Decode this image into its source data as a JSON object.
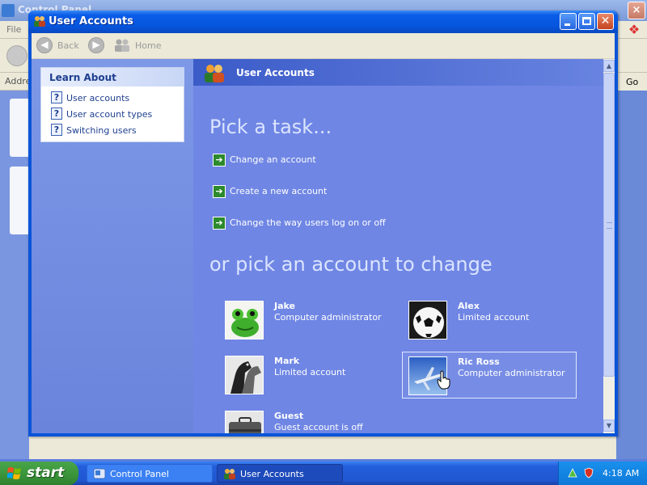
{
  "background_window": {
    "title": "Control Panel",
    "menu_first": "File",
    "address_label": "Address",
    "go_label": "Go"
  },
  "window": {
    "title": "User Accounts",
    "nav": {
      "back": "Back",
      "home": "Home"
    }
  },
  "learn_about": {
    "heading": "Learn About",
    "items": [
      {
        "label": "User accounts"
      },
      {
        "label": "User account types"
      },
      {
        "label": "Switching users"
      }
    ]
  },
  "main": {
    "header": "User Accounts",
    "pick_task": "Pick a task...",
    "tasks": [
      {
        "label": "Change an account"
      },
      {
        "label": "Create a new account"
      },
      {
        "label": "Change the way users log on or off"
      }
    ],
    "pick_account": "or pick an account to change",
    "accounts": [
      {
        "name": "Jake",
        "type": "Computer administrator",
        "picture": "frog"
      },
      {
        "name": "Alex",
        "type": "Limited account",
        "picture": "soccer-ball"
      },
      {
        "name": "Mark",
        "type": "Limited account",
        "picture": "horse"
      },
      {
        "name": "Ric Ross",
        "type": "Computer administrator",
        "picture": "airplane",
        "selected": true
      },
      {
        "name": "Guest",
        "type": "Guest account is off",
        "picture": "briefcase"
      }
    ]
  },
  "taskbar": {
    "start": "start",
    "items": [
      {
        "label": "Control Panel",
        "active": false
      },
      {
        "label": "User Accounts",
        "active": true
      }
    ],
    "clock": "4:18 AM"
  },
  "colors": {
    "titlebar": "#0a54d8",
    "content_bg": "#6f86e4",
    "taskbar": "#245edb",
    "start_green": "#3c963c"
  }
}
